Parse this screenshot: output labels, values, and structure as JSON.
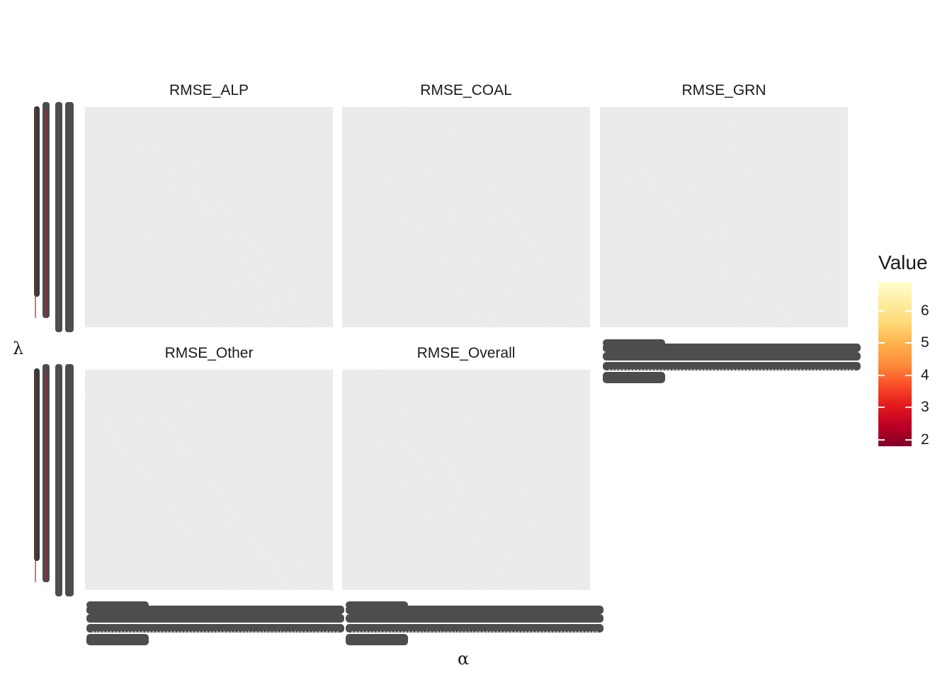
{
  "chart_data": {
    "type": "heatmap",
    "facets": [
      "RMSE_ALP",
      "RMSE_COAL",
      "RMSE_GRN",
      "RMSE_Other",
      "RMSE_Overall"
    ],
    "xlabel": "α",
    "ylabel": "λ",
    "legend": {
      "title": "Value",
      "position": "right",
      "range": [
        1.8,
        6.9
      ],
      "ticks": [
        2,
        3,
        4,
        5,
        6
      ],
      "colors": [
        "#800026",
        "#bd0026",
        "#e31a1c",
        "#fc4e2a",
        "#fd8d3c",
        "#feb24c",
        "#fed976",
        "#ffeda0",
        "#ffffcc"
      ]
    },
    "grid": true,
    "note_tick_labels": "overplotted and illegible"
  },
  "colors": {
    "panel_bg": "#ebebeb",
    "tick_text": "#4d4d4d"
  }
}
